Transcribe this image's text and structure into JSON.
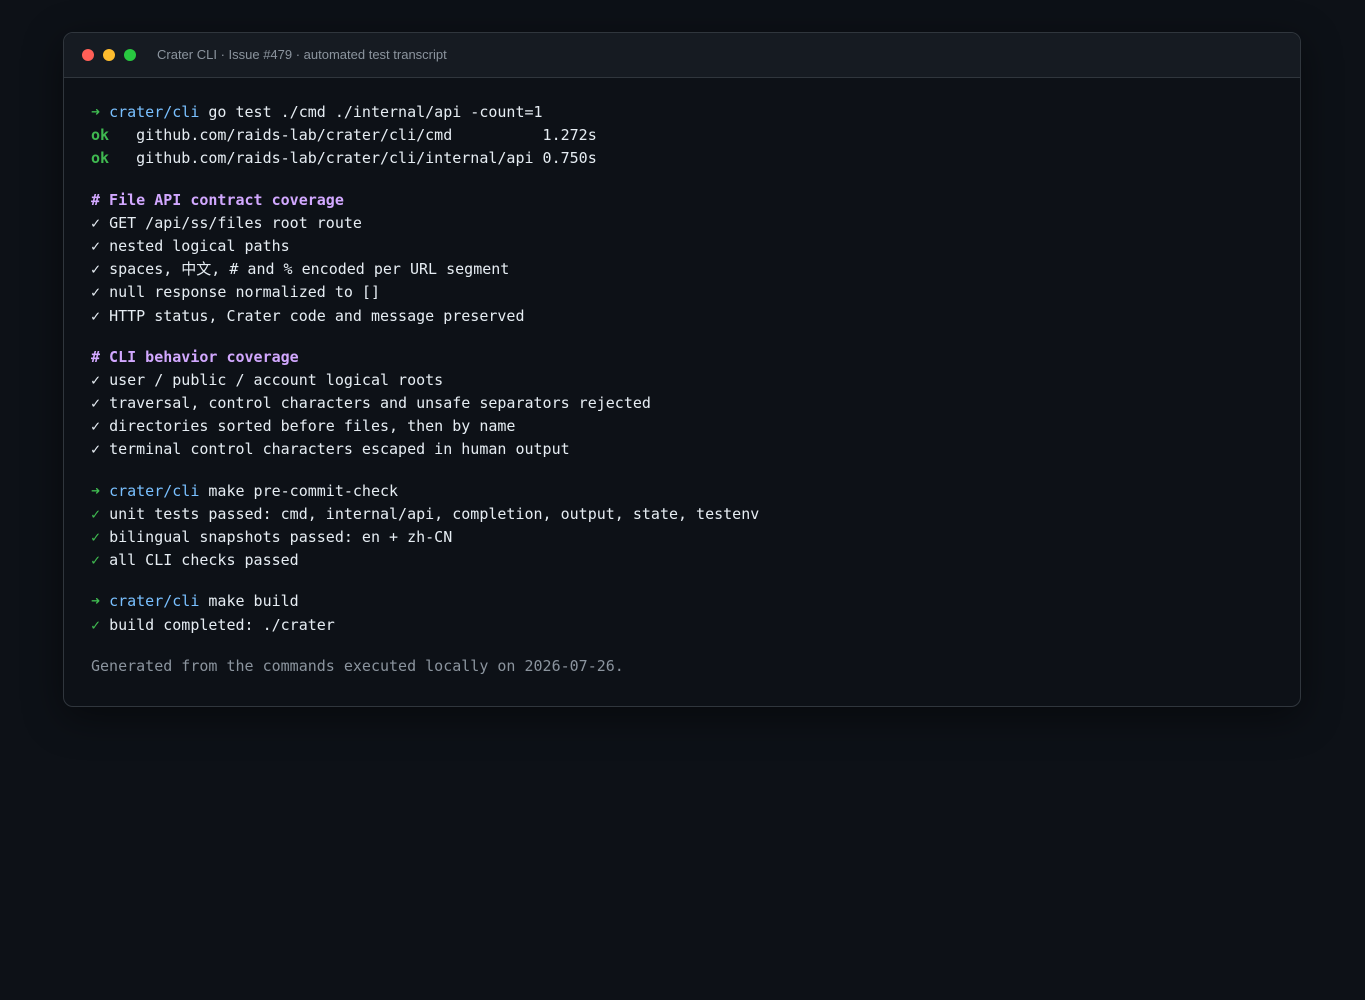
{
  "window": {
    "title": "Crater CLI · Issue #479 · automated test transcript"
  },
  "prompt_symbol": "➜",
  "cwd": "crater/cli",
  "check_symbol": "✓",
  "ok_label": "ok",
  "block1": {
    "command": "go test ./cmd ./internal/api -count=1",
    "results": [
      {
        "package": "github.com/raids-lab/crater/cli/cmd         ",
        "time": "1.272s"
      },
      {
        "package": "github.com/raids-lab/crater/cli/internal/api",
        "time": "0.750s"
      }
    ]
  },
  "section1": {
    "heading": "# File API contract coverage",
    "items": [
      "GET /api/ss/files root route",
      "nested logical paths",
      "spaces, 中文, # and % encoded per URL segment",
      "null response normalized to []",
      "HTTP status, Crater code and message preserved"
    ]
  },
  "section2": {
    "heading": "# CLI behavior coverage",
    "items": [
      "user / public / account logical roots",
      "traversal, control characters and unsafe separators rejected",
      "directories sorted before files, then by name",
      "terminal control characters escaped in human output"
    ]
  },
  "block2": {
    "command": "make pre-commit-check",
    "results": [
      "unit tests passed: cmd, internal/api, completion, output, state, testenv",
      "bilingual snapshots passed: en + zh-CN",
      "all CLI checks passed"
    ]
  },
  "block3": {
    "command": "make build",
    "results": [
      "build completed: ./crater"
    ]
  },
  "footer": "Generated from the commands executed locally on 2026-07-26.",
  "colors": {
    "background": "#0d1117",
    "prompt": "#3fb950",
    "cwd": "#79c0ff",
    "heading": "#d2a8ff",
    "muted": "#8b949e"
  }
}
